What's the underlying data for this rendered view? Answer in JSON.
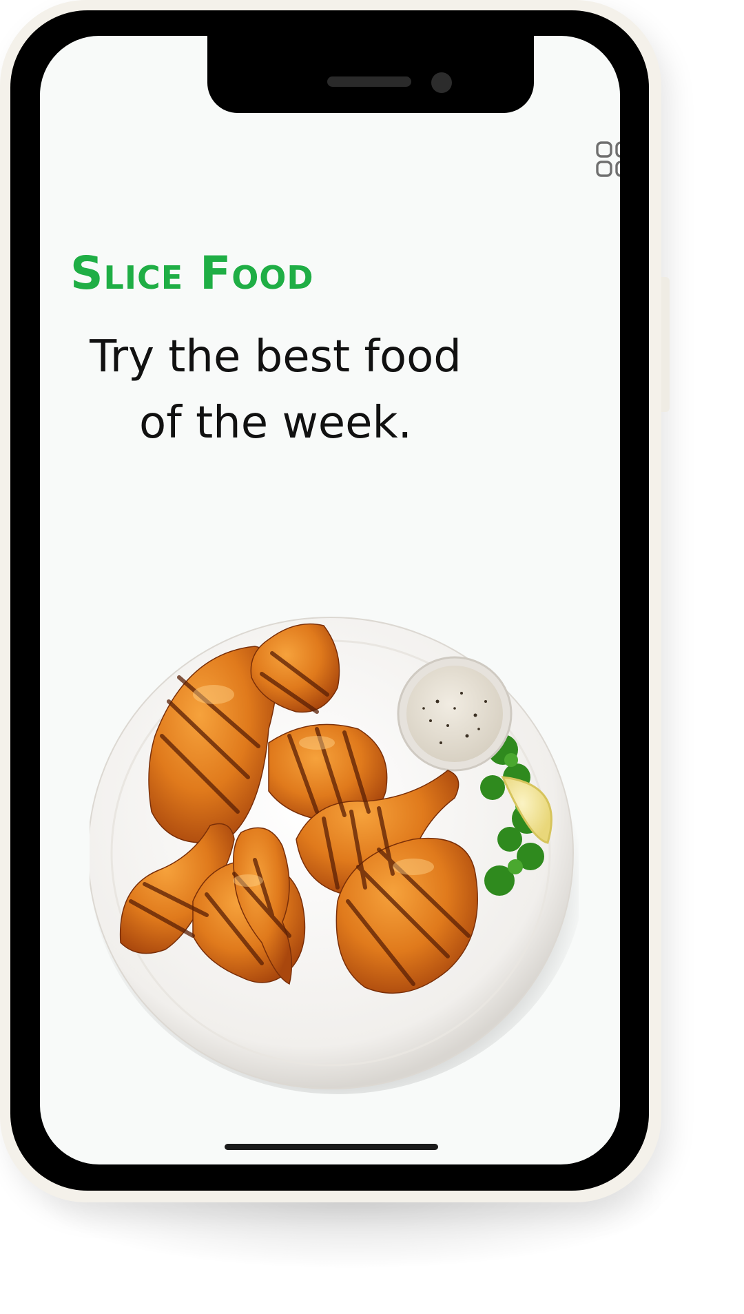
{
  "app": {
    "brand_name": "Slice Food",
    "brand_color": "#1fae45",
    "tagline": "Try the best food of the week."
  },
  "header": {
    "menu_icon": "grid-menu-icon"
  },
  "hero": {
    "image": "grilled-chicken-plate-with-dip"
  },
  "colors": {
    "screen_background": "#f8faf9",
    "phone_frame": "#f4f1ea",
    "bezel": "#000000",
    "text": "#111111"
  }
}
